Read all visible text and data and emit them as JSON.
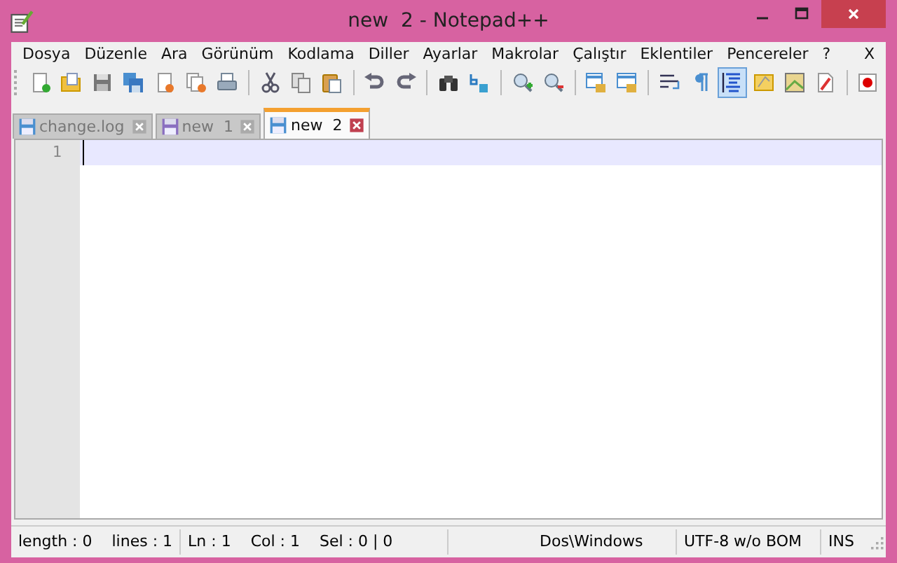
{
  "window": {
    "title": "new  2 - Notepad++"
  },
  "menu": [
    "Dosya",
    "Düzenle",
    "Ara",
    "Görünüm",
    "Kodlama",
    "Diller",
    "Ayarlar",
    "Makrolar",
    "Çalıştır",
    "Eklentiler",
    "Pencereler",
    "?"
  ],
  "menu_close": "X",
  "toolbar": [
    {
      "pressed": false
    },
    {
      "pressed": false
    },
    {
      "pressed": false
    },
    {
      "pressed": false
    },
    {
      "pressed": false
    },
    {
      "pressed": false
    },
    {
      "pressed": false
    },
    {
      "pressed": false
    },
    {
      "pressed": false
    },
    {
      "pressed": false
    },
    {
      "pressed": false
    },
    {
      "pressed": false
    },
    {
      "pressed": false
    },
    {
      "pressed": false
    },
    {
      "pressed": false
    },
    {
      "pressed": false
    },
    {
      "pressed": false
    },
    {
      "pressed": false
    },
    {
      "pressed": false
    },
    {
      "pressed": false
    },
    {
      "pressed": true
    },
    {
      "pressed": false
    },
    {
      "pressed": false
    },
    {
      "pressed": false
    },
    {
      "pressed": false
    }
  ],
  "tabs": [
    {
      "label": "change.log",
      "selected": false,
      "color": "#4a8fd0"
    },
    {
      "label": "new  1",
      "selected": false,
      "color": "#8a6fc0"
    },
    {
      "label": "new  2",
      "selected": true,
      "color": "#4a8fd0"
    }
  ],
  "editor": {
    "lines": [
      "1"
    ]
  },
  "status_bar": [
    "length : 0    lines : 1",
    "Ln : 1    Col : 1    Sel : 0 | 0",
    "Dos\\Windows",
    "UTF-8 w/o BOM",
    "INS"
  ]
}
